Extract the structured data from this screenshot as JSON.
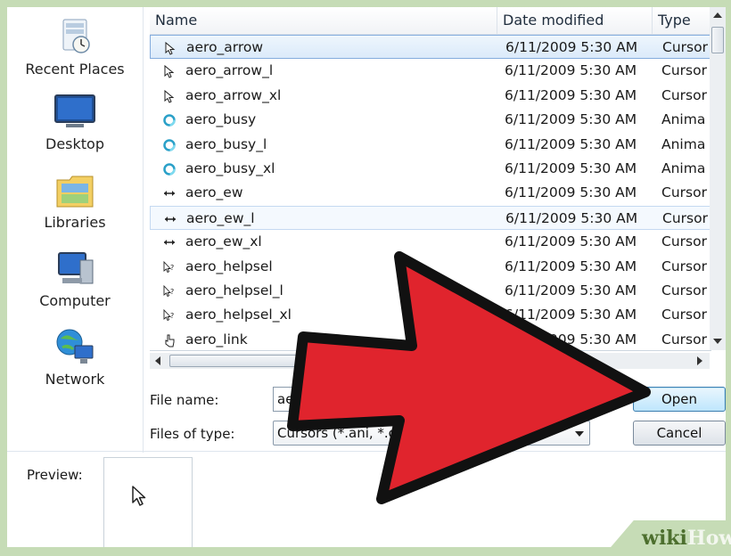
{
  "nav": {
    "items": [
      {
        "label": "Recent Places",
        "icon": "recent-places-icon"
      },
      {
        "label": "Desktop",
        "icon": "desktop-icon"
      },
      {
        "label": "Libraries",
        "icon": "libraries-icon"
      },
      {
        "label": "Computer",
        "icon": "computer-icon"
      },
      {
        "label": "Network",
        "icon": "network-icon"
      }
    ]
  },
  "list": {
    "columns": {
      "name": "Name",
      "date": "Date modified",
      "type": "Type"
    },
    "rows": [
      {
        "name": "aero_arrow",
        "date": "6/11/2009 5:30 AM",
        "type": "Cursor",
        "icon": "cursor-arrow-icon",
        "state": "selected"
      },
      {
        "name": "aero_arrow_l",
        "date": "6/11/2009 5:30 AM",
        "type": "Cursor",
        "icon": "cursor-arrow-icon"
      },
      {
        "name": "aero_arrow_xl",
        "date": "6/11/2009 5:30 AM",
        "type": "Cursor",
        "icon": "cursor-arrow-icon"
      },
      {
        "name": "aero_busy",
        "date": "6/11/2009 5:30 AM",
        "type": "Anima",
        "icon": "busy-ring-icon"
      },
      {
        "name": "aero_busy_l",
        "date": "6/11/2009 5:30 AM",
        "type": "Anima",
        "icon": "busy-ring-icon"
      },
      {
        "name": "aero_busy_xl",
        "date": "6/11/2009 5:30 AM",
        "type": "Anima",
        "icon": "busy-ring-icon"
      },
      {
        "name": "aero_ew",
        "date": "6/11/2009 5:30 AM",
        "type": "Cursor",
        "icon": "resize-ew-icon"
      },
      {
        "name": "aero_ew_l",
        "date": "6/11/2009 5:30 AM",
        "type": "Cursor",
        "icon": "resize-ew-icon",
        "state": "hover"
      },
      {
        "name": "aero_ew_xl",
        "date": "6/11/2009 5:30 AM",
        "type": "Cursor",
        "icon": "resize-ew-icon"
      },
      {
        "name": "aero_helpsel",
        "date": "6/11/2009 5:30 AM",
        "type": "Cursor",
        "icon": "help-cursor-icon"
      },
      {
        "name": "aero_helpsel_l",
        "date": "6/11/2009 5:30 AM",
        "type": "Cursor",
        "icon": "help-cursor-icon"
      },
      {
        "name": "aero_helpsel_xl",
        "date": "6/11/2009 5:30 AM",
        "type": "Cursor",
        "icon": "help-cursor-icon"
      },
      {
        "name": "aero_link",
        "date": "6/11/2009 5:30 AM",
        "type": "Cursor",
        "icon": "hand-cursor-icon"
      }
    ]
  },
  "file_name": {
    "label": "File name:",
    "value": "aero_arrow"
  },
  "file_type": {
    "label": "Files of type:",
    "value": "Cursors (*.ani, *.cur)"
  },
  "buttons": {
    "open": "Open",
    "cancel": "Cancel"
  },
  "preview": {
    "label": "Preview:"
  },
  "watermark": {
    "part1": "wiki",
    "part2": "How"
  },
  "colors": {
    "selection": "#dbeafa",
    "accent_arrow": "#e0242d",
    "default_button": "#bee6fd"
  }
}
